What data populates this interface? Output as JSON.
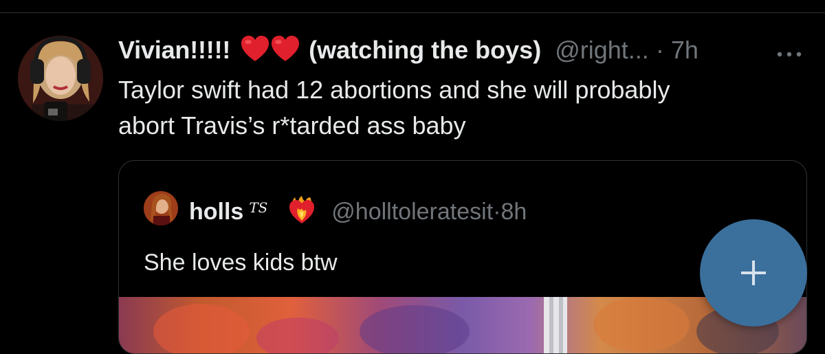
{
  "post": {
    "display_name": "Vivian!!!!!",
    "display_name_rest": "(watching the boys)",
    "handle": "@right...",
    "separator": "·",
    "time": "7h",
    "text": "Taylor swift had 12 abortions and she will  probably\nabort  Travis’s r*tarded ass baby",
    "icons": {
      "name_emoji_1": "red-heart-icon",
      "name_emoji_2": "red-heart-icon",
      "more": "more-options-icon"
    }
  },
  "quote": {
    "display_name": "holls",
    "badge_text": "TS",
    "handle": "@holltoleratesit",
    "separator": "·",
    "time": "8h",
    "text": "She loves kids btw",
    "icons": {
      "name_emoji": "heart-on-fire-icon"
    }
  },
  "fab": {
    "icon": "plus-icon",
    "color": "#3b6f9c"
  },
  "colors": {
    "background": "#000000",
    "text_primary": "#e7e9ea",
    "text_secondary": "#71767b",
    "border": "#2f3336",
    "heart": "#e0202c"
  }
}
